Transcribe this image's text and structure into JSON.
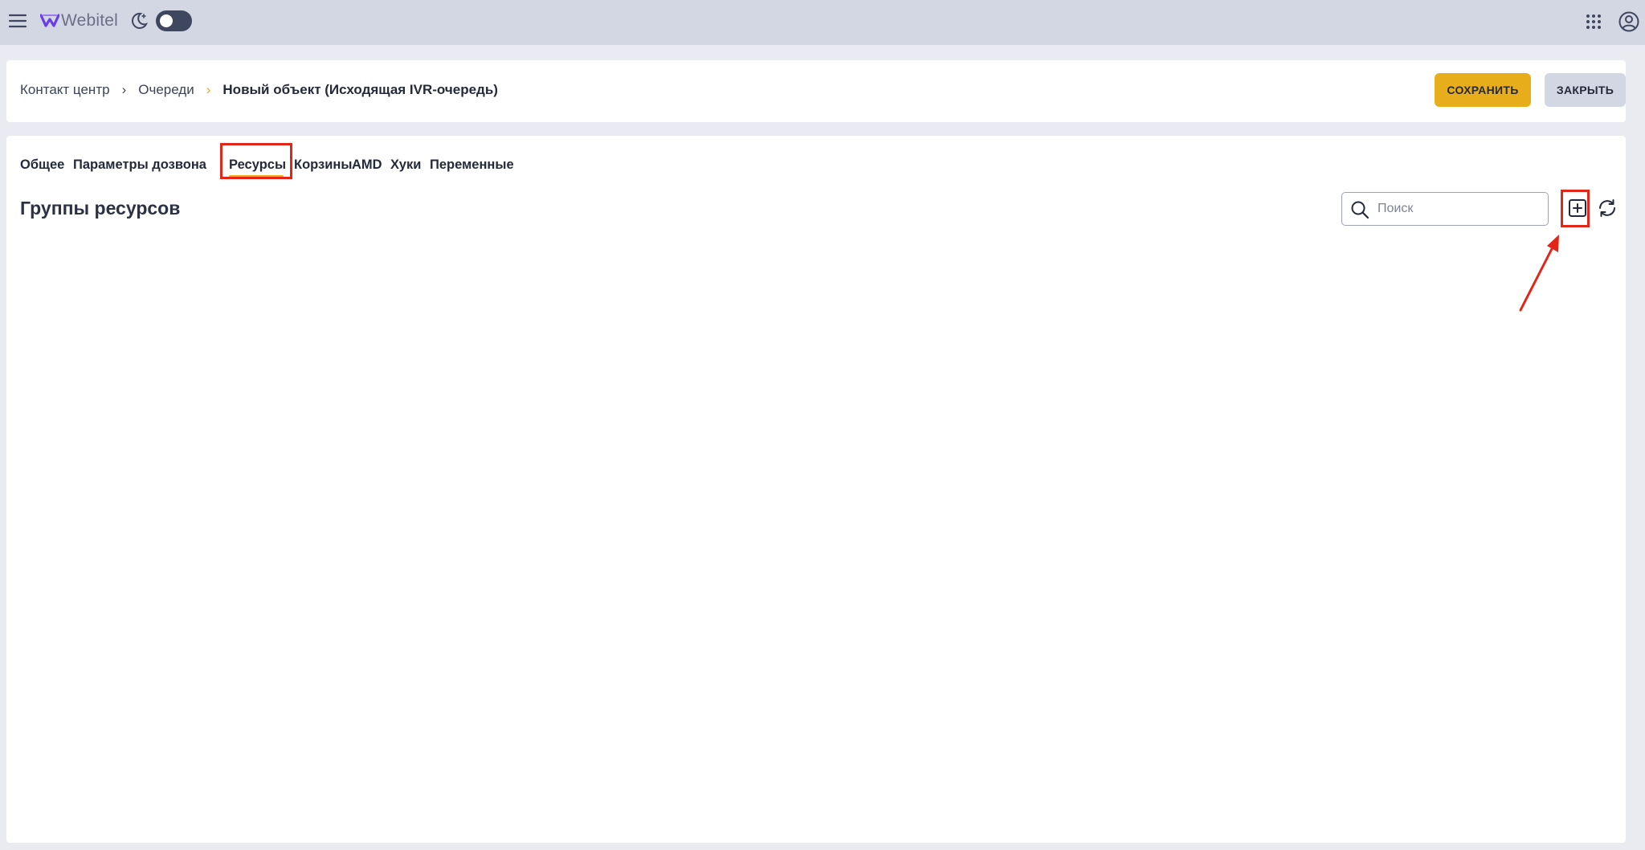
{
  "topbar": {
    "logo_text": "Webitel",
    "logo_color": "#6a3de8",
    "toggle_color": "#3f475f"
  },
  "header": {
    "breadcrumb": [
      {
        "label": "Контакт центр"
      },
      {
        "label": "Очереди"
      },
      {
        "label": "Новый объект (Исходящая IVR-очередь)"
      }
    ],
    "save_label": "СОХРАНИТЬ",
    "close_label": "ЗАКРЫТЬ",
    "accent_color": "#e8ad1a"
  },
  "tabs": [
    {
      "label": "Общее"
    },
    {
      "label": "Параметры дозвона"
    },
    {
      "label": "Ресурсы",
      "active": true
    },
    {
      "label": "Корзины"
    },
    {
      "label": "AMD"
    },
    {
      "label": "Хуки"
    },
    {
      "label": "Переменные"
    }
  ],
  "section": {
    "title": "Группы ресурсов",
    "search_placeholder": "Поиск"
  },
  "annotation_color": "#e3261a"
}
